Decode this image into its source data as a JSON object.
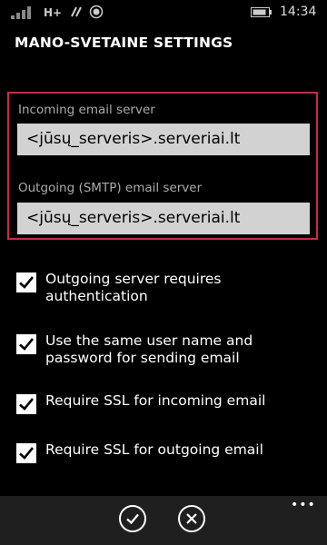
{
  "status_bar": {
    "network": "H+",
    "time": "14:34"
  },
  "title": "MANO-SVETAINE SETTINGS",
  "incoming": {
    "label": "Incoming email server",
    "value": "<jūsų_serveris>.serveriai.lt"
  },
  "outgoing": {
    "label": "Outgoing (SMTP) email server",
    "value": "<jūsų_serveris>.serveriai.lt"
  },
  "options": [
    {
      "label": "Outgoing server requires authentication",
      "checked": true
    },
    {
      "label": "Use the same user name and password for sending email",
      "checked": true
    },
    {
      "label": "Require SSL for incoming email",
      "checked": true
    },
    {
      "label": "Require SSL for outgoing email",
      "checked": true
    }
  ],
  "appbar": {
    "more": "•••"
  },
  "colors": {
    "highlight": "#d2234b",
    "input_bg": "#d2d2d2"
  }
}
